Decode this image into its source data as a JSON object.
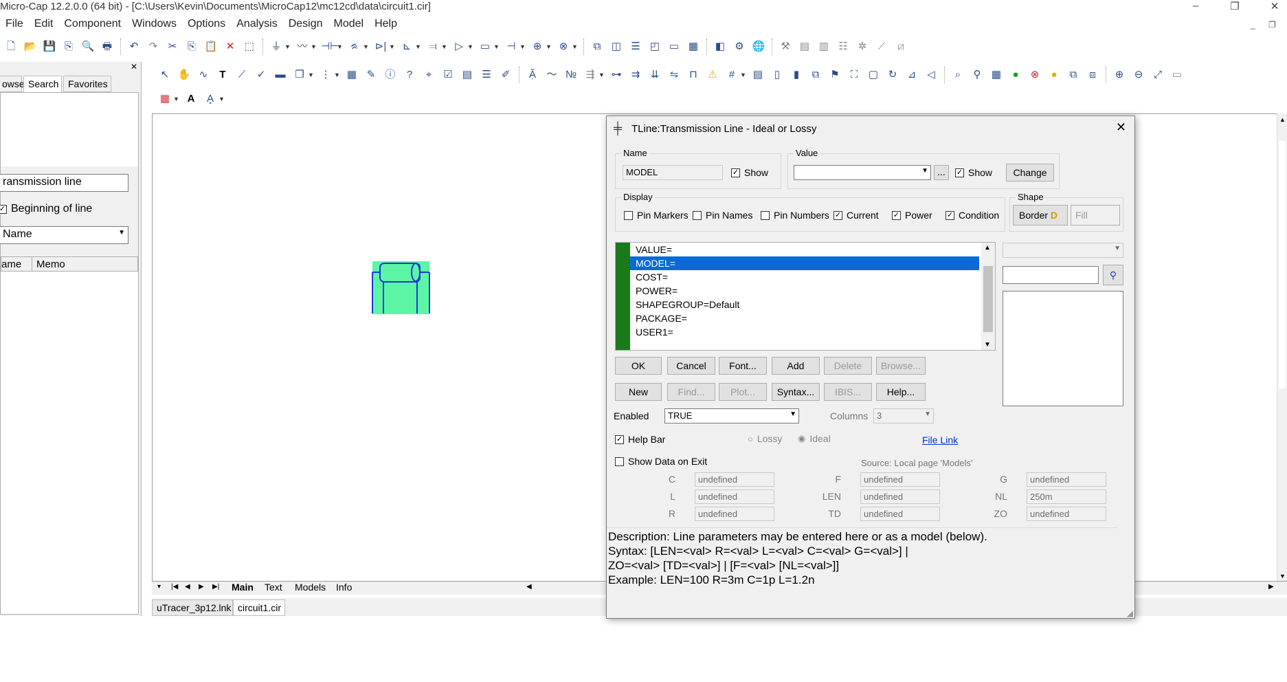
{
  "window": {
    "title": "Micro-Cap 12.2.0.0 (64 bit) - [C:\\Users\\Kevin\\Documents\\MicroCap12\\mc12cd\\data\\circuit1.cir]",
    "minimize": "–",
    "restore": "❐",
    "close": "✕"
  },
  "menu": [
    "File",
    "Edit",
    "Component",
    "Windows",
    "Options",
    "Analysis",
    "Design",
    "Model",
    "Help"
  ],
  "left_panel": {
    "close": "✕",
    "tabs": [
      "owse",
      "Search",
      "Favorites"
    ],
    "search_value": "ransmission line",
    "beginning_of_line": "Beginning of line",
    "field_select": "Name",
    "columns": [
      "ame",
      "Memo"
    ]
  },
  "sheet_tabs": [
    "Main",
    "Text",
    "Models",
    "Info"
  ],
  "file_tabs": [
    "uTracer_3p12.lnk",
    "circuit1.cir"
  ],
  "dialog": {
    "title": "TLine:Transmission Line - Ideal or Lossy",
    "name_group": "Name",
    "name_value": "MODEL",
    "name_show": "Show",
    "value_group": "Value",
    "value_value": "",
    "ellipsis": "...",
    "value_show": "Show",
    "change": "Change",
    "display_group": "Display",
    "display_options": [
      {
        "label": "Pin Markers",
        "checked": false
      },
      {
        "label": "Pin Names",
        "checked": false
      },
      {
        "label": "Pin Numbers",
        "checked": false
      },
      {
        "label": "Current",
        "checked": true
      },
      {
        "label": "Power",
        "checked": true
      },
      {
        "label": "Condition",
        "checked": true
      }
    ],
    "shape_group": "Shape",
    "border": "Border",
    "fill": "Fill",
    "attributes": [
      "VALUE=",
      "MODEL=",
      "COST=",
      "POWER=",
      "SHAPEGROUP=Default",
      "PACKAGE=",
      "USER1="
    ],
    "selected_attribute": "MODEL=",
    "buttons_row1": [
      {
        "label": "OK",
        "enabled": true
      },
      {
        "label": "Cancel",
        "enabled": true
      },
      {
        "label": "Font...",
        "enabled": true
      },
      {
        "label": "Add",
        "enabled": true
      },
      {
        "label": "Delete",
        "enabled": false
      },
      {
        "label": "Browse...",
        "enabled": false
      }
    ],
    "buttons_row2": [
      {
        "label": "New",
        "enabled": true
      },
      {
        "label": "Find...",
        "enabled": false
      },
      {
        "label": "Plot...",
        "enabled": false
      },
      {
        "label": "Syntax...",
        "enabled": true
      },
      {
        "label": "IBIS...",
        "enabled": false
      },
      {
        "label": "Help...",
        "enabled": true
      }
    ],
    "enabled_label": "Enabled",
    "enabled_value": "TRUE",
    "columns_label": "Columns",
    "columns_value": "3",
    "help_bar": "Help Bar",
    "lossy": "Lossy",
    "ideal": "Ideal",
    "file_link": "File Link",
    "show_data_on_exit": "Show Data on Exit",
    "source": "Source: Local page 'Models'",
    "params": [
      {
        "name": "C",
        "value": "undefined"
      },
      {
        "name": "F",
        "value": "undefined"
      },
      {
        "name": "G",
        "value": "undefined"
      },
      {
        "name": "L",
        "value": "undefined"
      },
      {
        "name": "LEN",
        "value": "undefined"
      },
      {
        "name": "NL",
        "value": "250m"
      },
      {
        "name": "R",
        "value": "undefined"
      },
      {
        "name": "TD",
        "value": "undefined"
      },
      {
        "name": "ZO",
        "value": "undefined"
      }
    ],
    "description": [
      "Description: Line parameters may be entered here or as a model (below).",
      "Syntax: [LEN=<val> R=<val> L=<val> C=<val> G=<val>] |",
      "ZO=<val> [TD=<val>] | [F=<val> [NL=<val>]]",
      "Example: LEN=100 R=3m C=1p L=1.2n"
    ]
  },
  "colors": {
    "selection": "#0b6ad6",
    "stripe": "#1a7a1a",
    "component_fill": "#5cf5a6",
    "component_stroke": "#1a3ad6",
    "link": "#0033cc"
  }
}
